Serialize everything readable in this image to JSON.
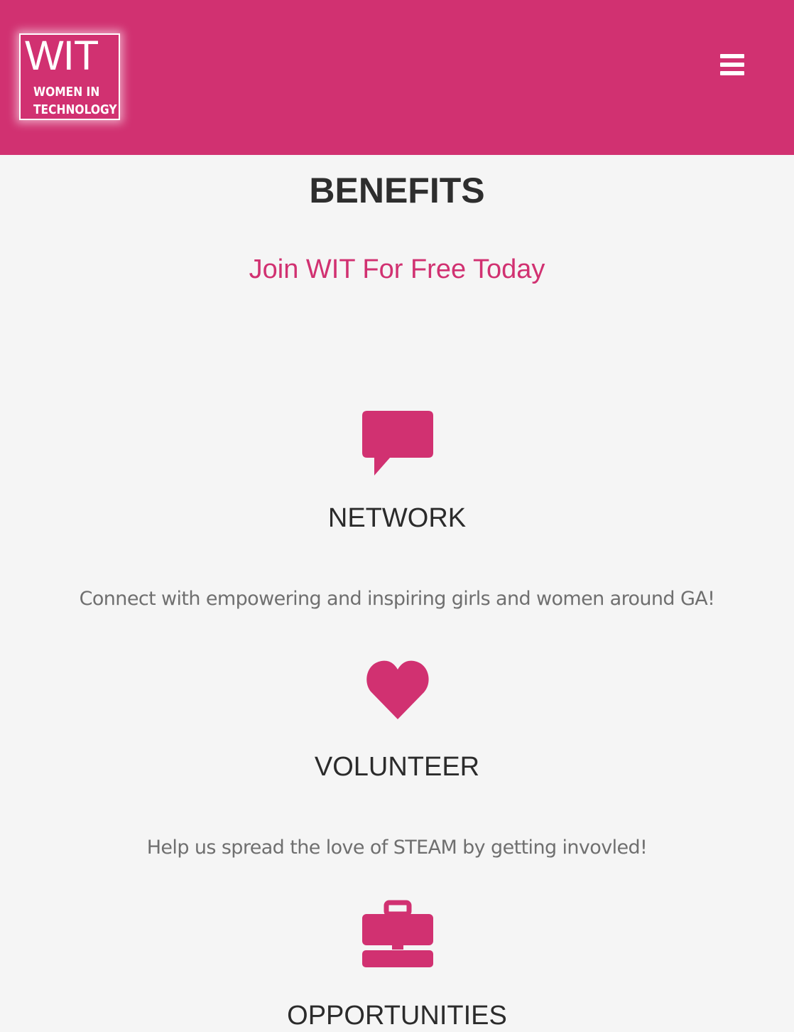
{
  "brand": {
    "logo_main": "WIT",
    "logo_line1": "WOMEN IN",
    "logo_line2": "TECHNOLOGY",
    "accent_color": "#d13171"
  },
  "header": {
    "menu_icon": "hamburger-menu-icon"
  },
  "benefits": {
    "title": "BENEFITS",
    "cta_label": "Join WIT For Free Today",
    "items": [
      {
        "icon": "speech-bubble-icon",
        "title": "NETWORK",
        "description": "Connect with empowering and inspiring girls and women around GA!"
      },
      {
        "icon": "heart-icon",
        "title": "VOLUNTEER",
        "description": "Help us spread the love of STEAM by getting invovled!"
      },
      {
        "icon": "briefcase-icon",
        "title": "OPPORTUNITIES",
        "description": ""
      }
    ]
  }
}
